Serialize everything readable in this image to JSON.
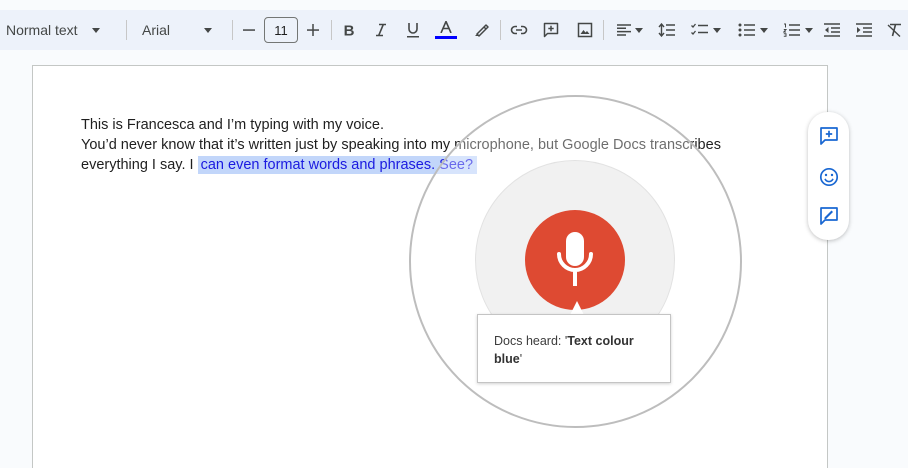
{
  "toolbar": {
    "style_label": "Normal text",
    "font_label": "Arial",
    "font_size": "11",
    "text_color": "#0000ff"
  },
  "document": {
    "lines": [
      "This is Francesca and I’m typing with my voice.",
      "You’d never know that it’s written just by speaking into my microphone, but Google Docs transcribes"
    ],
    "line3_plain": "everything I say. I",
    "line3_selected": "can even format words and phrases. See?"
  },
  "voice_typing": {
    "heard_prefix": "Docs heard: '",
    "heard_command": "Text colour blue",
    "heard_suffix": "'",
    "mic_color": "#de4a32"
  },
  "colors": {
    "accent": "#1967d2",
    "selection": "#c2d6fa"
  }
}
